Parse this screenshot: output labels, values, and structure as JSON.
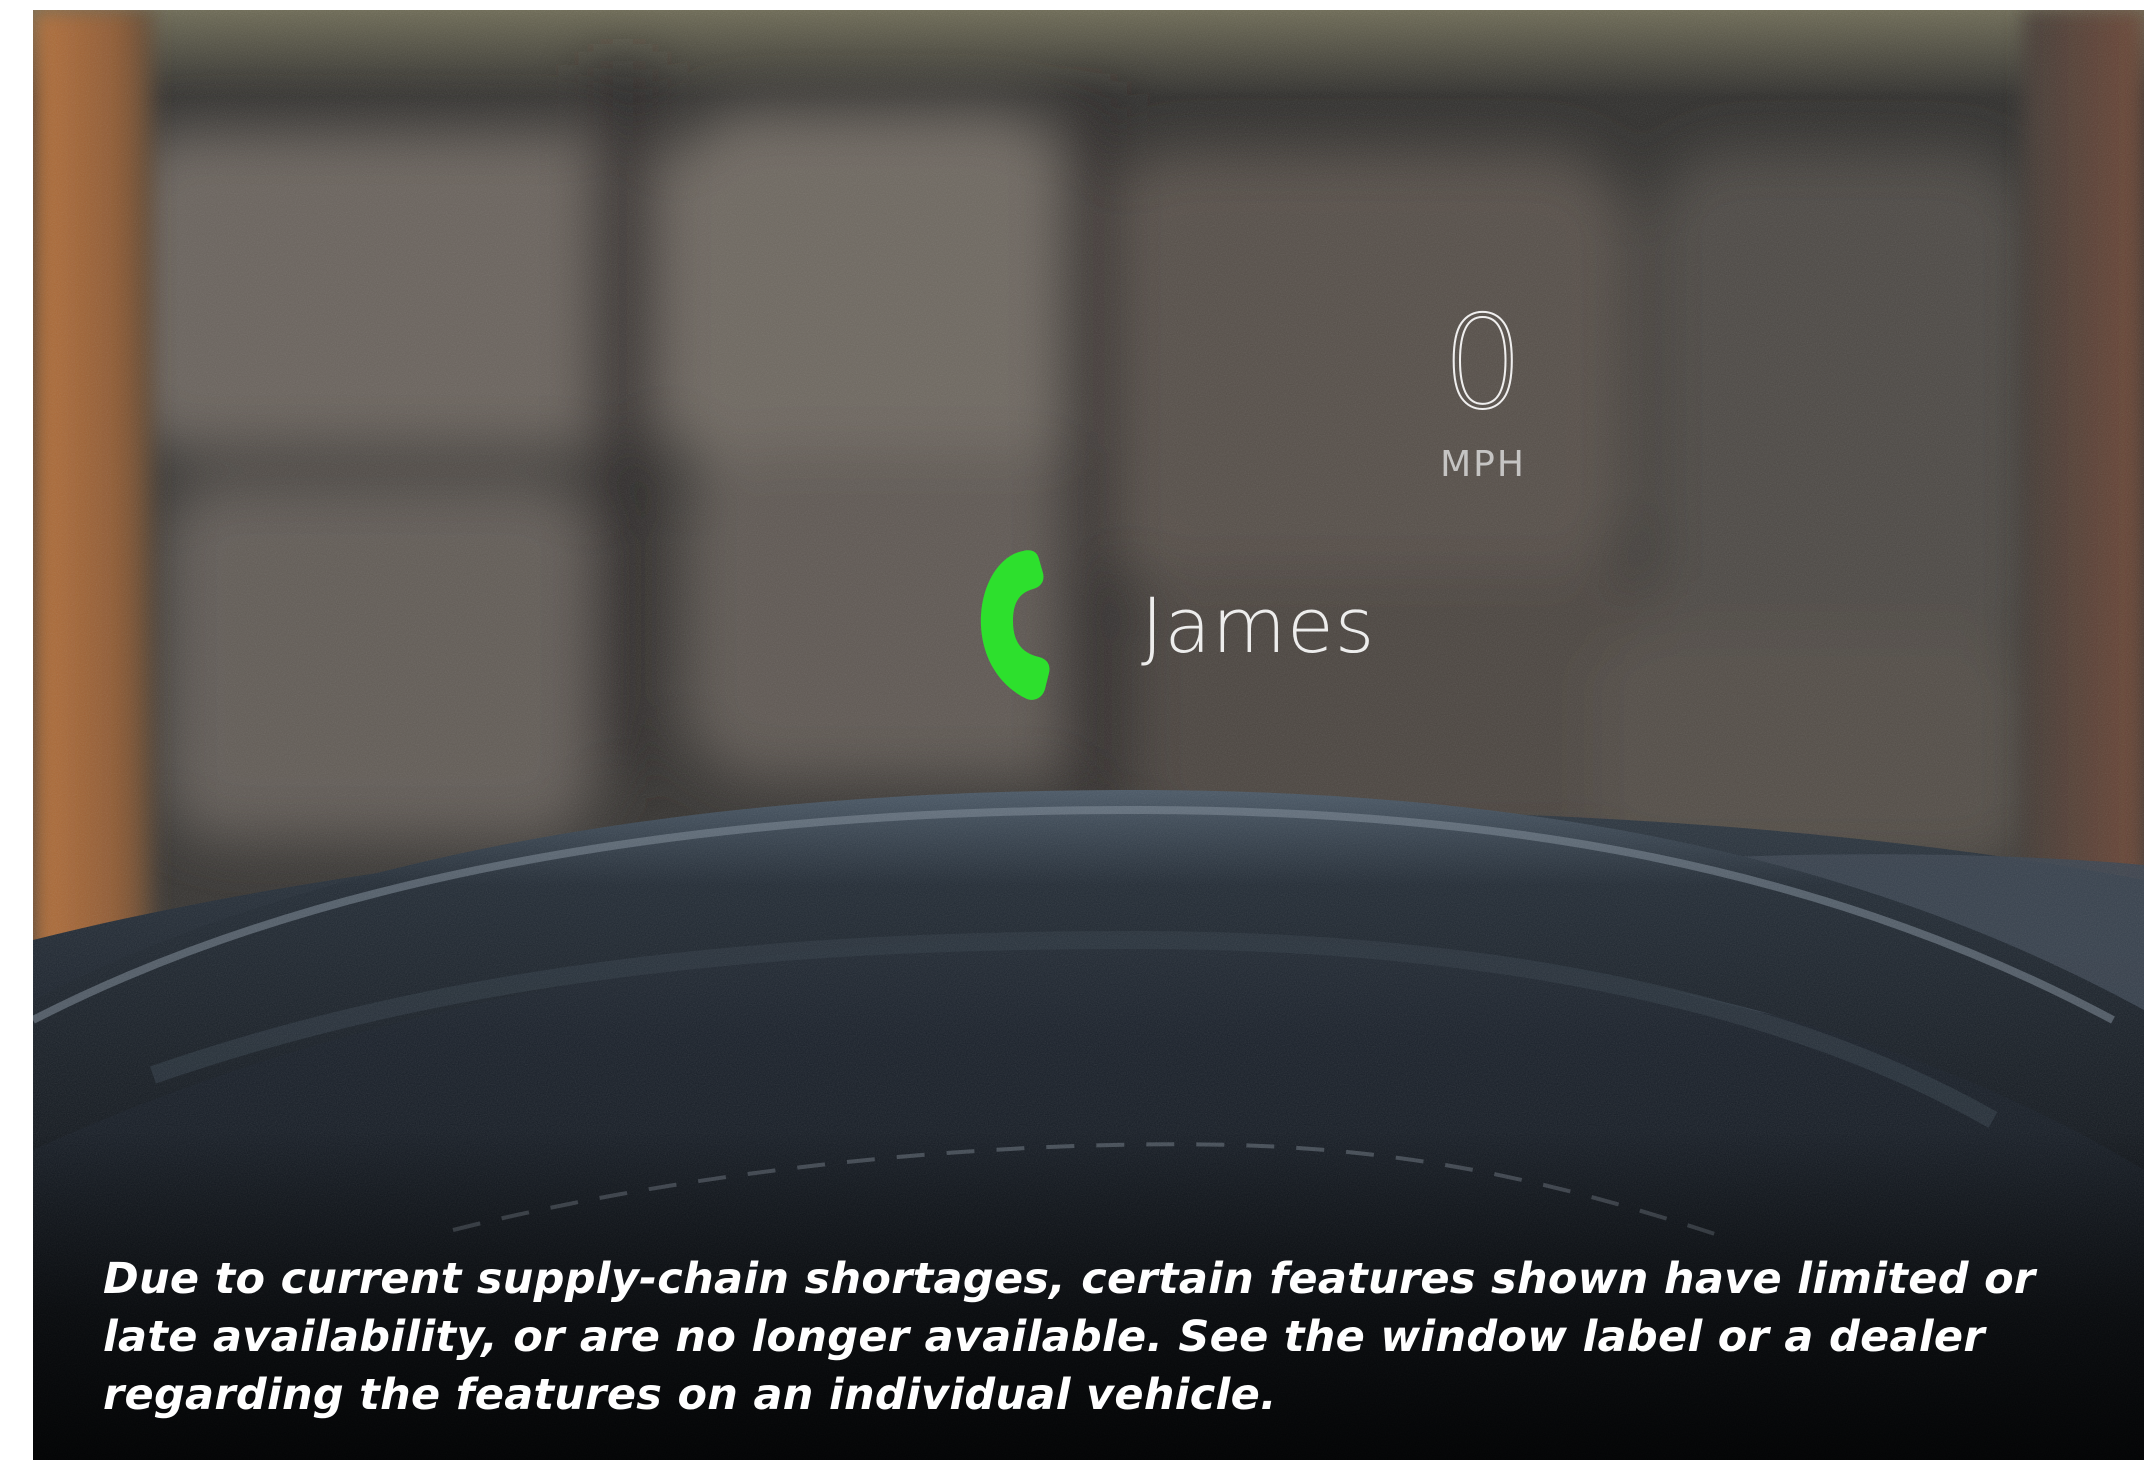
{
  "hud": {
    "speed_value": "0",
    "speed_unit": "MPH",
    "caller_name": "James",
    "call_icon": "phone-icon",
    "call_icon_color": "#2de02d"
  },
  "disclaimer": {
    "text": "Due to current supply-chain shortages, certain features shown have limited or late availability, or are no longer available. See the window label or a dealer regarding the features on an individual vehicle."
  },
  "colors": {
    "dashboard": "#1c2228",
    "caption_text": "#ffffff",
    "hud_text": "#f3f3f3"
  }
}
